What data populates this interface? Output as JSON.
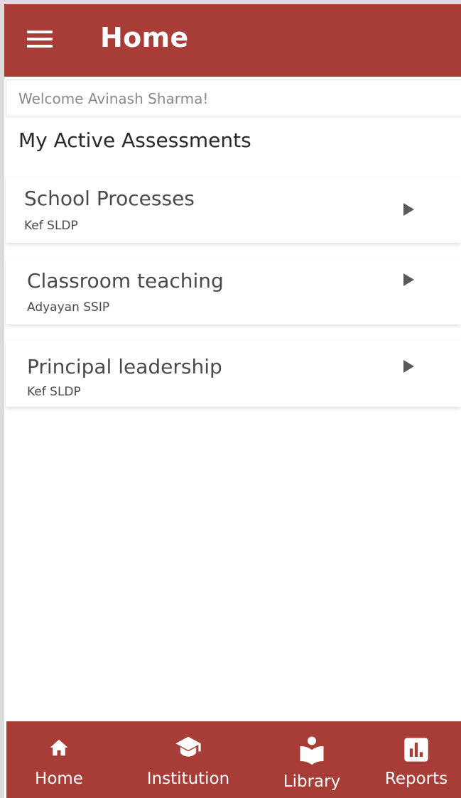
{
  "header": {
    "title": "Home",
    "background_color": "#a83c36",
    "menu_icon": "hamburger-menu-icon"
  },
  "welcome": {
    "text": "Welcome Avinash Sharma!"
  },
  "assessments": {
    "heading": "My Active Assessments",
    "items": [
      {
        "title": "School Processes",
        "subtitle": "Kef SLDP",
        "icon": "chevron-right-icon"
      },
      {
        "title": "Classroom teaching",
        "subtitle": "Adyayan SSIP",
        "icon": "chevron-right-icon"
      },
      {
        "title": "Principal leadership",
        "subtitle": "Kef SLDP",
        "icon": "chevron-right-icon"
      }
    ]
  },
  "bottom_nav": {
    "background_color": "#a83c36",
    "items": [
      {
        "label": "Home",
        "icon": "home-icon"
      },
      {
        "label": "Institution",
        "icon": "graduation-cap-icon"
      },
      {
        "label": "Library",
        "icon": "library-book-icon"
      },
      {
        "label": "Reports",
        "icon": "bar-chart-icon"
      }
    ]
  }
}
